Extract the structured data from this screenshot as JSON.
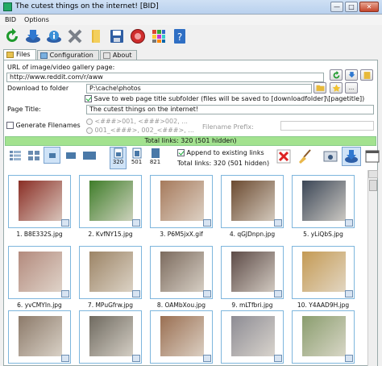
{
  "window": {
    "title": "The cutest things on the internet! [BID]",
    "min": "—",
    "max": "□",
    "close": "✕"
  },
  "menu": {
    "items": [
      "BID",
      "Options"
    ]
  },
  "toolbar": {
    "buttons": [
      "refresh-icon",
      "download-icon",
      "info-icon",
      "cancel-icon",
      "folder-icon",
      "save-icon",
      "record-icon",
      "grid-icon",
      "help-icon"
    ]
  },
  "tabs": [
    {
      "label": "Files"
    },
    {
      "label": "Configuration"
    },
    {
      "label": "About"
    }
  ],
  "form": {
    "url_label": "URL of image/video gallery page:",
    "url_value": "http://www.reddit.com/r/aww",
    "folder_label": "Download to folder",
    "folder_value": "P:\\cache\\photos",
    "save_subfolder_label": "Save to web page title subfolder (files will be saved to [downloadfolder]\\[pagetitle])",
    "page_title_label": "Page Title:",
    "page_title_value": "The cutest things on the internet!",
    "generate_filenames_label": "Generate Filenames",
    "radio1": "<###>001, <###>002, ...",
    "radio2": "001_<###>, 002_<###>, ...",
    "filename_prefix_label": "Filename Prefix:"
  },
  "status": {
    "total_links": "Total links: 320 (501 hidden)"
  },
  "view": {
    "sizes": [
      "320",
      "501",
      "821"
    ],
    "append_label": "Append to existing links",
    "total_links": "Total links: 320 (501 hidden)"
  },
  "colors": {
    "accent": "#3a8fd6",
    "status_green": "#a3e28f",
    "thumb_border": "#7eb6dd"
  },
  "thumbnails": [
    {
      "caption": "1. B8E332S.jpg",
      "color": "#8a2e25"
    },
    {
      "caption": "2. KvfNY15.jpg",
      "color": "#3f7d2a"
    },
    {
      "caption": "3. P6M5jxX.gif",
      "color": "#a67a5c"
    },
    {
      "caption": "4. qGJDnpn.jpg",
      "color": "#6b4a30"
    },
    {
      "caption": "5. yLiQbS.jpg",
      "color": "#3b4656"
    },
    {
      "caption": "6. yvCMYIn.jpg",
      "color": "#b38a7d"
    },
    {
      "caption": "7. MPuGfrw.jpg",
      "color": "#9c8466"
    },
    {
      "caption": "8. OAMbXou.jpg",
      "color": "#7c6b5e"
    },
    {
      "caption": "9. mLTfbri.jpg",
      "color": "#5d4b47"
    },
    {
      "caption": "10. Y4AAD9H.jpg",
      "color": "#c49a54"
    },
    {
      "caption": "",
      "color": "#8c7a6a"
    },
    {
      "caption": "",
      "color": "#6f6a60"
    },
    {
      "caption": "",
      "color": "#9a6f52"
    },
    {
      "caption": "",
      "color": "#8d8c94"
    },
    {
      "caption": "",
      "color": "#8a9d6e"
    }
  ]
}
